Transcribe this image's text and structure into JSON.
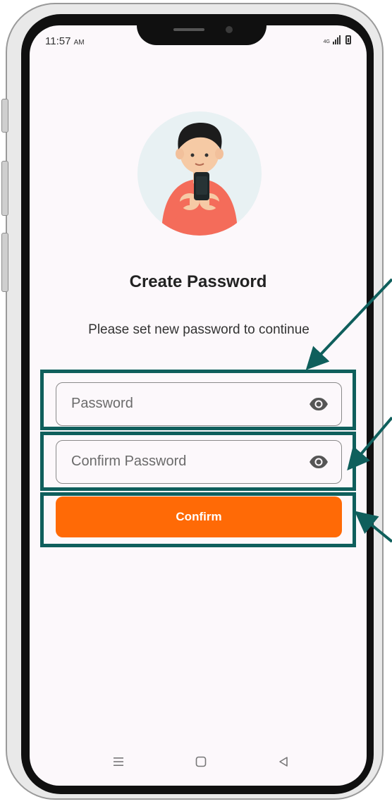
{
  "status_bar": {
    "time": "11:57",
    "ampm": "AM",
    "network": "4G"
  },
  "screen": {
    "title": "Create Password",
    "subtitle": "Please set new password to continue"
  },
  "form": {
    "password_placeholder": "Password",
    "confirm_placeholder": "Confirm Password",
    "confirm_label": "Confirm"
  },
  "icons": {
    "password_toggle": "eye-icon",
    "confirm_toggle": "eye-icon",
    "nav_menu": "menu-icon",
    "nav_home": "square-icon",
    "nav_back": "triangle-back-icon"
  },
  "colors": {
    "accent": "#ff6a06",
    "highlight": "#0f5f5c",
    "screen_bg": "#fcf8fb"
  }
}
